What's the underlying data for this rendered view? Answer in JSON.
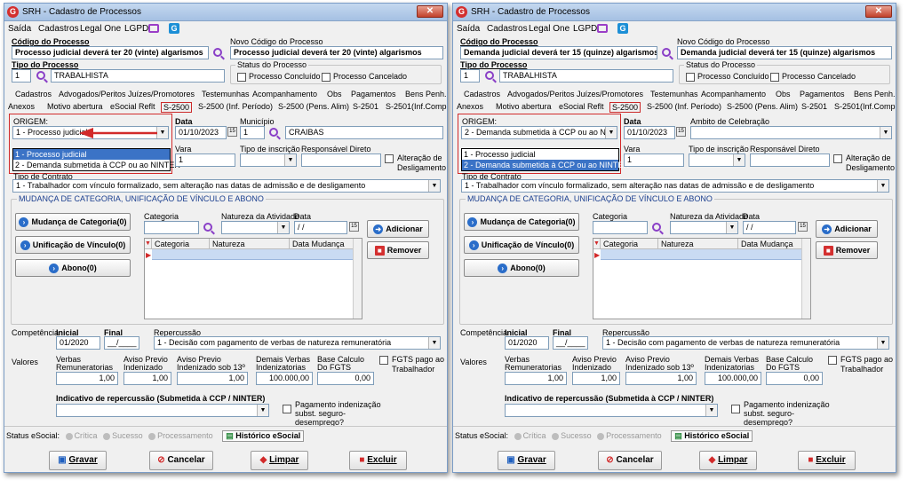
{
  "title": "SRH - Cadastro de Processos",
  "close_glyph": "✕",
  "menu": [
    "Saída",
    "Cadastros",
    "Legal One",
    "LGPD"
  ],
  "left": {
    "codigo_label": "Código do Processo",
    "codigo_value": "Processo judicial deverá ter 20 (vinte) algarismos",
    "novo_label": "Novo Código do Processo",
    "novo_value": "Processo judicial deverá ter 20 (vinte) algarismos",
    "dropdown": [
      "1 - Processo judicial",
      "2 - Demanda submetida à CCP ou ao NINTER"
    ],
    "origem_value": "1 - Processo judicial",
    "municipio_label": "Município",
    "municipio_code": "1",
    "municipio_name": "CRAIBAS"
  },
  "right": {
    "codigo_label": "Código do Processo",
    "codigo_value": "Demanda judicial deverá ter 15 (quinze) algarismos",
    "novo_label": "Novo Código do Processo",
    "novo_value": "Demanda judicial deverá ter 15 (quinze) algarismos",
    "dropdown": [
      "1 - Processo judicial",
      "2 - Demanda submetida à CCP ou ao NINTER"
    ],
    "origem_value": "2 - Demanda submetida à CCP ou ao NINTER",
    "ambito_label": "Ambito de Celebração"
  },
  "common": {
    "tipo_label": "Tipo do Processo",
    "tipo_code": "1",
    "tipo_name": "TRABALHISTA",
    "status_label": "Status do Processo",
    "concluido": "Processo Concluído",
    "cancelado": "Processo Cancelado",
    "tabs1": [
      "Cadastros",
      "Advogados/Peritos",
      "Juízes/Promotores",
      "Testemunhas",
      "Acompanhamento",
      "Obs",
      "Pagamentos",
      "Bens Penh."
    ],
    "tabs2": [
      "Anexos",
      "Motivo abertura",
      "eSocial Reflt",
      "S-2500",
      "S-2500 (Inf. Período)",
      "S-2500 (Pens. Alim)",
      "S-2501",
      "S-2501(Inf.Compl)"
    ],
    "origem_label": "ORIGEM:",
    "data_label": "Data",
    "data_value": "01/10/2023",
    "vara_label": "Vara",
    "vara_value": "1",
    "tipo_insc_label": "Tipo de inscrição",
    "resp_label": "Responsável Direto",
    "alteracao_label": "Alteração de Desligamento",
    "tipo_contrato_label": "Tipo de Contrato",
    "tipo_contrato_value": "1 - Trabalhador com vínculo formalizado, sem alteração nas datas de admissão e de desligamento",
    "mudanca_group": "MUDANÇA DE CATEGORIA, UNIFICAÇÃO DE VÍNCULO E ABONO",
    "btn_mudanca": "Mudança de Categoria(0)",
    "btn_unificacao": "Unificação de Vínculo(0)",
    "btn_abono": "Abono(0)",
    "categoria_label": "Categoria",
    "natureza_label": "Natureza da Atividade",
    "data2_label": "Data",
    "data2_value": " / /",
    "btn_adicionar": "Adicionar",
    "btn_remover": "Remover",
    "grid_headers": [
      "Categoria",
      "Natureza",
      "Data Mudança"
    ],
    "competencia_label": "Competência",
    "inicial_label": "Inicial",
    "final_label": "Final",
    "inicial_value": "01/2020",
    "final_value": "__/____",
    "repercussao_label": "Repercussão",
    "repercussao_value": "1 - Decisão com pagamento de verbas de natureza remuneratória",
    "valores_label": "Valores",
    "verbas_label": "Verbas Remuneratorias",
    "aviso_label": "Aviso Previo Indenizado",
    "aviso13_label": "Aviso Previo Indenizado sob 13º",
    "demais_label": "Demais Verbas Indenizatorias",
    "base_label": "Base Calculo Do FGTS",
    "fgts_label": "FGTS pago ao Trabalhador",
    "verbas_value": "1,00",
    "aviso_value": "1,00",
    "aviso13_value": "1,00",
    "demais_value": "100.000,00",
    "base_value": "0,00",
    "indicativo_label": "Indicativo de repercussão (Submetida à CCP / NINTER)",
    "pagamento_label": "Pagamento indenização subst. seguro-desemprego?",
    "status_esocial": "Status eSocial:",
    "critica": "Crítica",
    "sucesso": "Sucesso",
    "processamento": "Processamento",
    "historico": "Histórico eSocial",
    "gravar": "Gravar",
    "cancelar": "Cancelar",
    "limpar": "Limpar",
    "excluir": "Excluir"
  }
}
